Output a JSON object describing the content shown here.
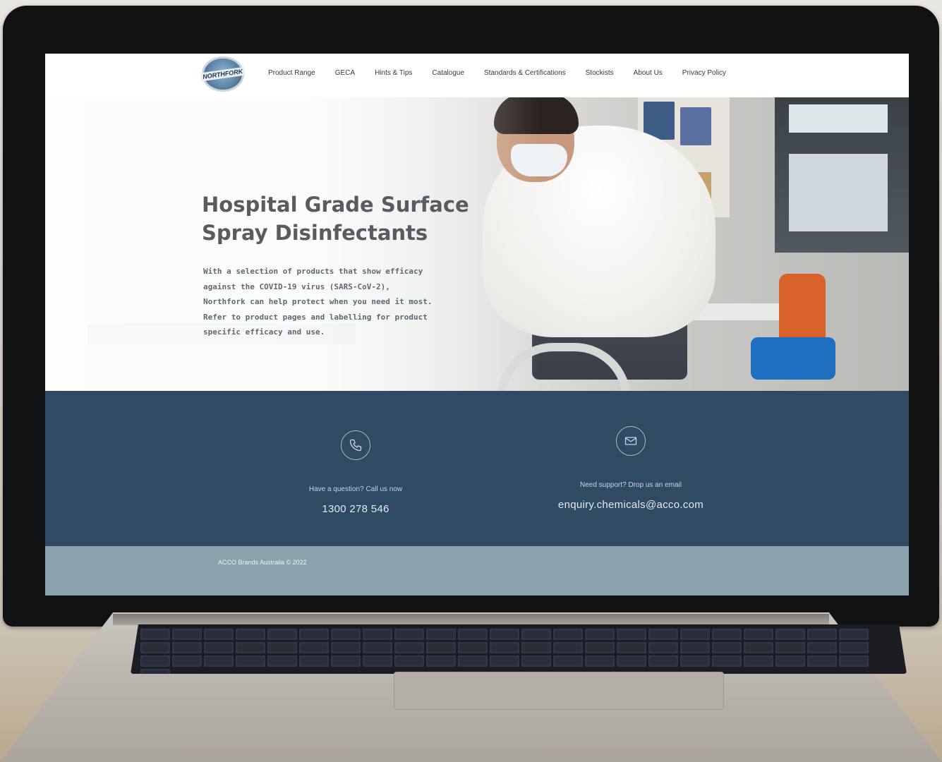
{
  "site": {
    "logo_text": "NORTHFORK",
    "nav": [
      {
        "label": "Product Range"
      },
      {
        "label": "GECA"
      },
      {
        "label": "Hints & Tips"
      },
      {
        "label": "Catalogue"
      },
      {
        "label": "Standards & Certifications"
      },
      {
        "label": "Stockists"
      },
      {
        "label": "About Us"
      },
      {
        "label": "Privacy Policy"
      }
    ]
  },
  "hero": {
    "title_line1": "Hospital Grade Surface",
    "title_line2": "Spray Disinfectants",
    "body_lines": [
      "With a selection of products that show efficacy",
      "against the COVID-19 virus (SARS-CoV-2),",
      "Northfork can help protect when you need it most.",
      "Refer to product pages and labelling for product",
      "specific efficacy and use."
    ]
  },
  "contact": {
    "phone": {
      "icon": "phone-icon",
      "label": "Have a question? Call us now",
      "value": "1300 278 546"
    },
    "email": {
      "icon": "email-icon",
      "label": "Need support? Drop us an email",
      "value": "enquiry.chemicals@acco.com"
    }
  },
  "footer": {
    "text": "ACCO Brands Australia © 2022"
  },
  "colors": {
    "contact_bg": "#2f4a63",
    "footer_bg": "#8aa2ad",
    "laptop_bezel": "#111214"
  }
}
